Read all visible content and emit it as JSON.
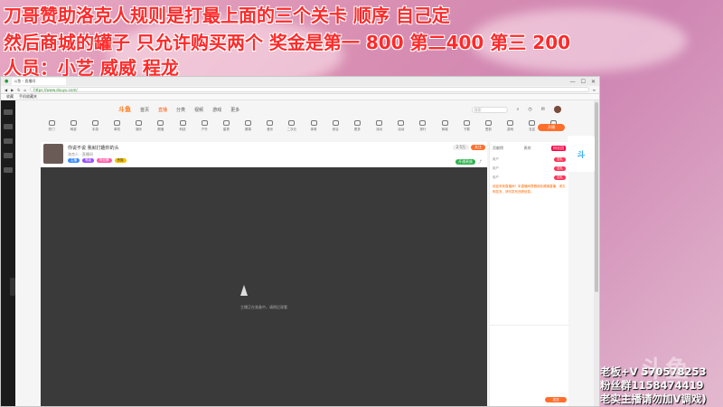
{
  "overlay": {
    "line1": "刀哥赞助洛克人规则是打最上面的三个关卡  顺序 自己定",
    "line2": " 然后商城的罐子 只允许购买两个  奖金是第一 800 第二400 第三 200",
    "line3": "人员：小艺     威威      程龙"
  },
  "browser": {
    "tab_title": "斗鱼 - 直播间",
    "url": "https://www.douyu.com/",
    "window_buttons": [
      "—",
      "☐",
      "✕"
    ],
    "favorites": [
      "收藏",
      "手机收藏夹"
    ]
  },
  "site": {
    "logo": "斗鱼",
    "nav": [
      "首页",
      "直播",
      "分类",
      "视频",
      "游戏",
      "更多"
    ],
    "search_placeholder": "搜索",
    "host_button": "开播"
  },
  "categories": [
    "热门",
    "网游",
    "手游",
    "单机",
    "娱乐",
    "颜值",
    "科技",
    "户外",
    "星秀",
    "赛事",
    "音乐",
    "二次元",
    "体育",
    "综合",
    "更多",
    "派对",
    "活动",
    "排行",
    "商城",
    "下载",
    "签到",
    "游戏",
    "社区",
    "热点"
  ],
  "room": {
    "title": "你说不说 我就打趣你的头",
    "meta": "洛克人 · 直播间",
    "badges": [
      "主播",
      "等级",
      "粉丝牌",
      "贵族"
    ],
    "follow": "关注",
    "follow_count": "2.5万",
    "vip_tag": "开通贵族",
    "video_message": "主播正在准备中，请稍后观看"
  },
  "sidebar": {
    "tabs": [
      "贡献榜",
      "贵宾",
      "粉丝团"
    ],
    "rows": [
      "用户",
      "用户",
      "用户"
    ],
    "row_action": "送礼",
    "chat": [
      "欢迎来到直播间！本直播间提倡绿色健康直播，请文明发言，请勿发布违规信息。"
    ],
    "send": "发送"
  },
  "contact": {
    "line1": "老板+V 570578253",
    "line2": "粉丝群1158474419",
    "line3": "老实主播请勿加V调戏)"
  },
  "watermark": "斗鱼"
}
